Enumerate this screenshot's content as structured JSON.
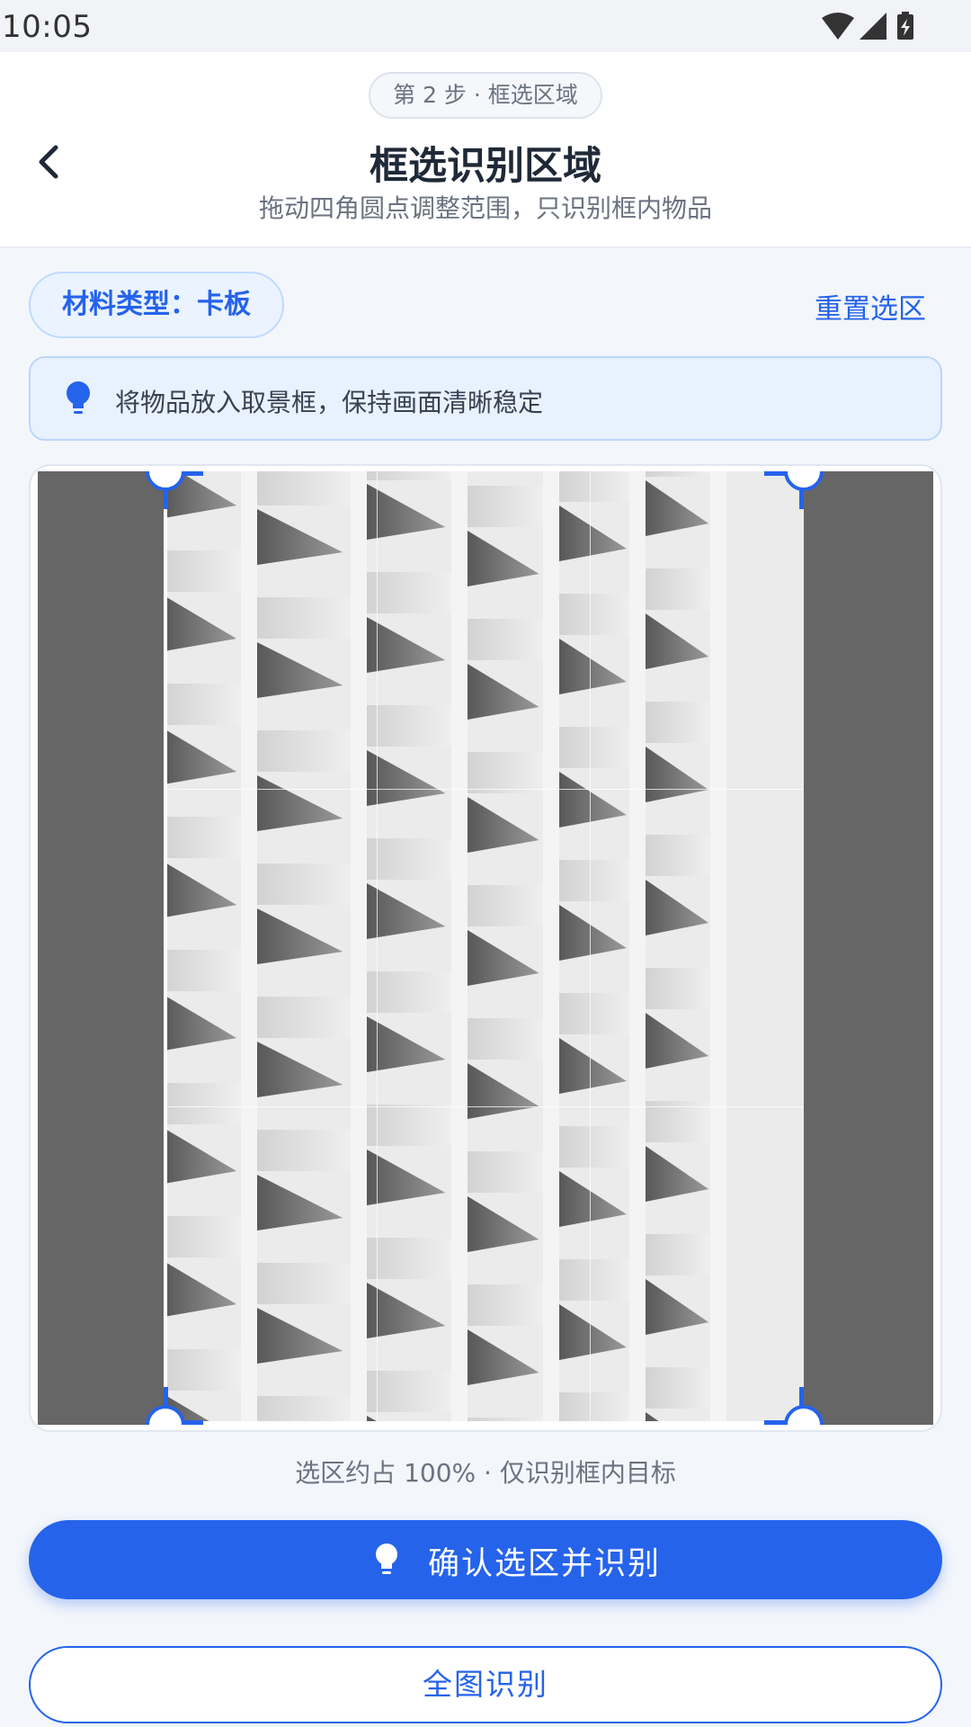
{
  "status_bar": {
    "time": "10:05",
    "icons": [
      "wifi-icon",
      "signal-icon",
      "battery-charging-icon"
    ]
  },
  "header": {
    "step_label": "第 2 步 · 框选区域",
    "title": "框选识别区域",
    "subtitle": "拖动四角圆点调整范围，只识别框内物品",
    "back_icon": "chevron-left-icon"
  },
  "toolbar": {
    "material_chip": "材料类型：卡板",
    "reset_label": "重置选区"
  },
  "tip": {
    "icon": "lightbulb-icon",
    "text": "将物品放入取景框，保持画面清晰稳定"
  },
  "cropper": {
    "image_subject": "white building facade",
    "selection_percent": 100
  },
  "selection_info": "选区约占 100% · 仅识别框内目标",
  "actions": {
    "confirm_label": "确认选区并识别",
    "confirm_icon": "lightbulb-icon",
    "full_image_label": "全图识别"
  },
  "colors": {
    "accent": "#2563eb",
    "background": "#f3f6fb",
    "tip_background": "#e8f1fe",
    "mask": "#666666"
  }
}
